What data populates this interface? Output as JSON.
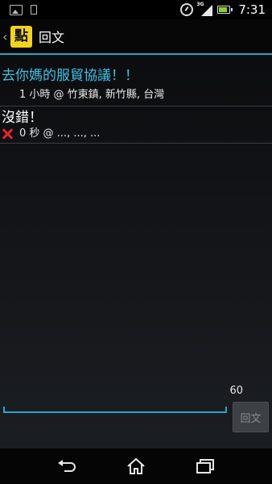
{
  "status_bar": {
    "network": "3G",
    "time": "7:31"
  },
  "action_bar": {
    "back_glyph": "‹",
    "logo_text": "點",
    "title": "回文"
  },
  "post": {
    "title": "去你媽的服貿協議！！",
    "meta": "1 小時 @ 竹東鎮, 新竹縣, 台灣"
  },
  "replies": [
    {
      "body": "沒錯！",
      "status_icon": "red-x-icon",
      "meta": "0 秒 @ ..., ..., ..."
    }
  ],
  "compose": {
    "char_count": "60",
    "input_value": "",
    "submit_label": "回文"
  },
  "nav": {
    "icons": [
      "back-icon",
      "home-icon",
      "recent-apps-icon"
    ]
  },
  "colors": {
    "accent": "#2aa6c7",
    "title_text": "#3ec3e6",
    "logo_bg": "#f2d41a",
    "error_red": "#e0262a"
  }
}
